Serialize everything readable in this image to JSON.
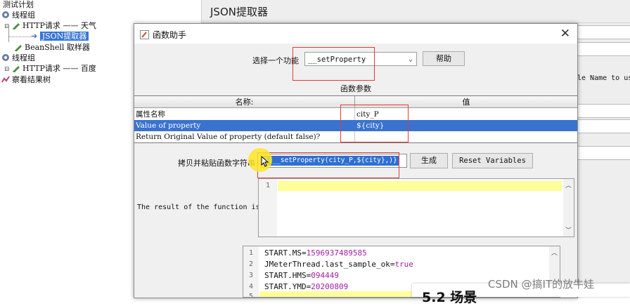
{
  "tree": {
    "items": [
      {
        "label": "测试计划",
        "level": 0
      },
      {
        "label": "线程组",
        "level": 1
      },
      {
        "label": "HTTP请求 —— 天气",
        "level": 2
      },
      {
        "label": "JSON提取器",
        "level": 3
      },
      {
        "label": "BeanShell 取样器",
        "level": 2
      },
      {
        "label": "线程组",
        "level": 1
      },
      {
        "label": "HTTP请求 —— 百度",
        "level": 2
      },
      {
        "label": "察看结果树",
        "level": 1
      }
    ]
  },
  "right_panel": {
    "title": "JSON提取器",
    "partial_label": "le Name to us"
  },
  "dialog": {
    "title": "函数助手",
    "select_label": "选择一个功能",
    "selected_function": "__setProperty",
    "help_button": "帮助",
    "params_title": "函数参数",
    "columns": {
      "name": "名称:",
      "value": "值"
    },
    "params": [
      {
        "name": "属性名称",
        "value": "city_P"
      },
      {
        "name": "Value of property",
        "value": "${city}"
      },
      {
        "name": "Return Original Value of property (default false)?",
        "value": ""
      }
    ],
    "copy_label": "拷贝并粘贴函数字符串",
    "function_string": "${__setProperty(city_P,${city},)}",
    "generate_button": "生成",
    "reset_button": "Reset Variables",
    "result_label": "The result of the function is",
    "result_line_number": "1",
    "variables": [
      {
        "n": "1",
        "key": "START.MS",
        "value": "1596937489585"
      },
      {
        "n": "2",
        "key": "JMeterThread.last_sample_ok",
        "value": "true"
      },
      {
        "n": "3",
        "key": "START.HMS",
        "value": "094449"
      },
      {
        "n": "4",
        "key": "START.YMD",
        "value": "20200809"
      },
      {
        "n": "5",
        "key": "",
        "value": ""
      }
    ]
  },
  "watermark": "CSDN @搞IT的放牛娃",
  "overlay_heading": "5.2 场景",
  "colors": {
    "selection": "#3a72cf",
    "highlight_box": "#e23b3b",
    "value_color": "#a020a0",
    "line_highlight": "#ffffcc"
  }
}
